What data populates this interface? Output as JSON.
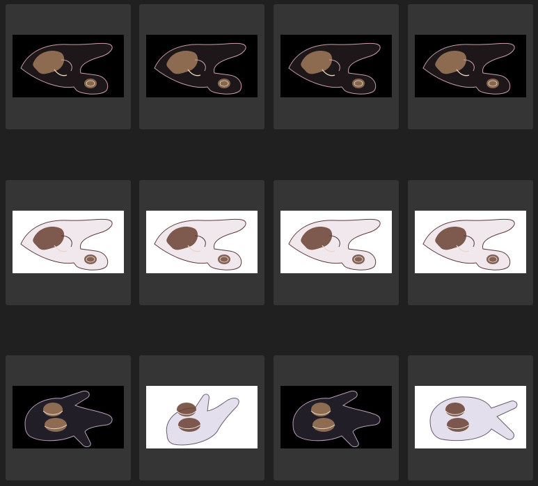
{
  "gallery": {
    "background": "#202020",
    "card_color": "#353535",
    "rows": [
      {
        "items": [
          {
            "theme": "dark",
            "subject": "single-fetus-womb-render",
            "selected": false
          },
          {
            "theme": "dark",
            "subject": "single-fetus-womb-render",
            "selected": false
          },
          {
            "theme": "dark",
            "subject": "single-fetus-womb-render",
            "selected": false
          },
          {
            "theme": "dark",
            "subject": "single-fetus-womb-render",
            "selected": false
          }
        ]
      },
      {
        "items": [
          {
            "theme": "light",
            "subject": "single-fetus-womb-render",
            "selected": false
          },
          {
            "theme": "light",
            "subject": "single-fetus-womb-render",
            "selected": false
          },
          {
            "theme": "light",
            "subject": "single-fetus-womb-render",
            "selected": false
          },
          {
            "theme": "light",
            "subject": "single-fetus-womb-render",
            "selected": false
          }
        ]
      },
      {
        "items": [
          {
            "theme": "dark",
            "subject": "twin-fetus-womb-render",
            "selected": false
          },
          {
            "theme": "light",
            "subject": "twin-fetus-womb-render",
            "selected": false
          },
          {
            "theme": "dark",
            "subject": "twin-fetus-womb-render",
            "selected": false
          },
          {
            "theme": "light",
            "subject": "twin-fetus-womb-render",
            "selected": false
          }
        ]
      }
    ]
  }
}
